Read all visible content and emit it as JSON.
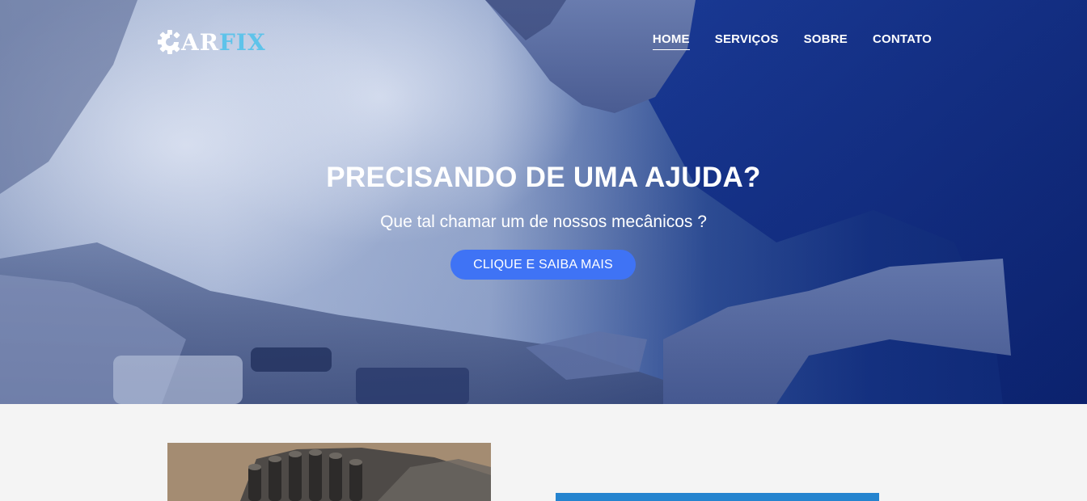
{
  "brand": {
    "logo_part1": "AR",
    "logo_part2": "FIX",
    "logo_icon": "gear-icon",
    "accent_color": "#5ec3ea"
  },
  "nav": {
    "items": [
      {
        "label": "HOME",
        "active": true
      },
      {
        "label": "SERVIÇOS",
        "active": false
      },
      {
        "label": "SOBRE",
        "active": false
      },
      {
        "label": "CONTATO",
        "active": false
      }
    ]
  },
  "hero": {
    "title": "PRECISANDO DE UMA AJUDA?",
    "subtitle": "Que tal chamar um de nossos mecânicos ?",
    "cta_label": "CLIQUE E SAIBA MAIS",
    "cta_color": "#3f73f5",
    "background": "mechanic-working-on-engine-photo"
  },
  "section": {
    "image": "engine-parts-photo",
    "bar_color": "#2584cf"
  }
}
